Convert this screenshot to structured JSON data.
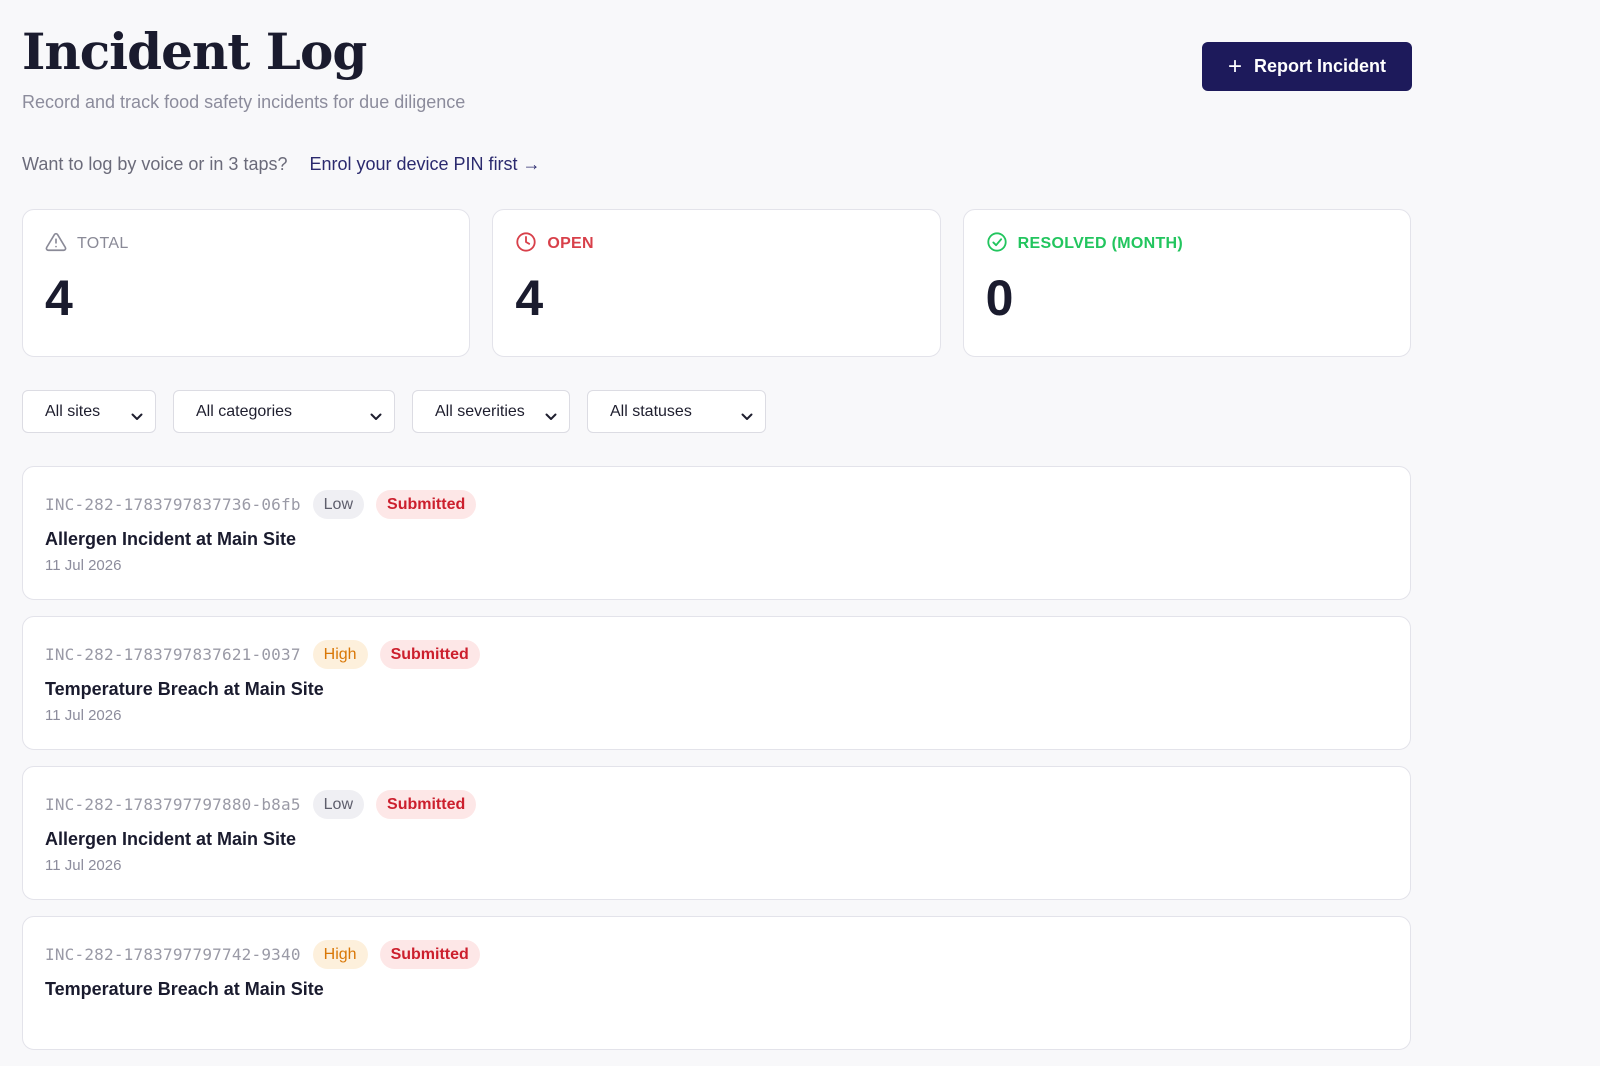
{
  "header": {
    "title": "Incident Log",
    "subtitle": "Record and track food safety incidents for due diligence",
    "report_button_icon": "plus-icon",
    "report_button_label": "Report Incident"
  },
  "voice_prompt": {
    "text": "Want to log by voice or in 3 taps?",
    "link_label": "Enrol your device PIN first →"
  },
  "stats": {
    "total": {
      "label": "TOTAL",
      "value": "4",
      "icon": "warning-triangle-icon",
      "color": "#8a8a97"
    },
    "open": {
      "label": "OPEN",
      "value": "4",
      "icon": "clock-icon",
      "color": "#d8404a"
    },
    "resolved": {
      "label": "RESOLVED (MONTH)",
      "value": "0",
      "icon": "check-circle-icon",
      "color": "#22c55e"
    }
  },
  "filters": {
    "sites": "All sites",
    "categories": "All categories",
    "severities": "All severities",
    "statuses": "All statuses"
  },
  "incidents": [
    {
      "id": "INC-282-1783797837736-06fb",
      "severity": "Low",
      "status": "Submitted",
      "title": "Allergen Incident at Main Site",
      "date": "11 Jul 2026"
    },
    {
      "id": "INC-282-1783797837621-0037",
      "severity": "High",
      "status": "Submitted",
      "title": "Temperature Breach at Main Site",
      "date": "11 Jul 2026"
    },
    {
      "id": "INC-282-1783797797880-b8a5",
      "severity": "Low",
      "status": "Submitted",
      "title": "Allergen Incident at Main Site",
      "date": "11 Jul 2026"
    },
    {
      "id": "INC-282-1783797797742-9340",
      "severity": "High",
      "status": "Submitted",
      "title": "Temperature Breach at Main Site",
      "date": ""
    }
  ],
  "colors": {
    "brand": "#1d1a5b",
    "link": "#2b2a6e",
    "submitted": "#cc1f2d",
    "high": "#d97706"
  }
}
